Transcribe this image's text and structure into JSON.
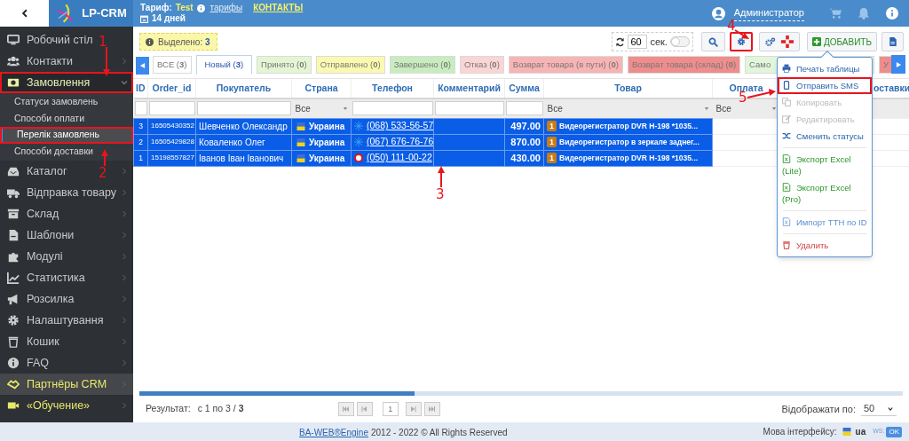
{
  "header": {
    "logo": "LP-CRM",
    "tariff_label": "Тариф:",
    "tariff": "Test",
    "tariffs_link": "тарифы",
    "contacts_link": "КОНТАКТЫ",
    "days": "14 дней",
    "user": "Администратор"
  },
  "sidebar": {
    "items": [
      {
        "label": "Робочий стіл",
        "submenu": false,
        "kind": "normal",
        "annotated": false
      },
      {
        "label": "Контакти",
        "submenu": true,
        "kind": "normal",
        "annotated": false
      },
      {
        "label": "Замовлення",
        "submenu": true,
        "kind": "normal",
        "annotated": true,
        "expanded": true,
        "children": [
          {
            "label": "Статуси замовлень",
            "selected": false,
            "annotated": false
          },
          {
            "label": "Способи оплати",
            "selected": false,
            "annotated": false
          },
          {
            "label": "Перелік замовлень",
            "selected": true,
            "annotated": true
          },
          {
            "label": "Способи доставки",
            "selected": false,
            "annotated": false
          }
        ]
      },
      {
        "label": "Каталог",
        "submenu": true,
        "kind": "normal",
        "annotated": false
      },
      {
        "label": "Відправка товару",
        "submenu": true,
        "kind": "normal",
        "annotated": false
      },
      {
        "label": "Склад",
        "submenu": true,
        "kind": "normal",
        "annotated": false
      },
      {
        "label": "Шаблони",
        "submenu": true,
        "kind": "normal",
        "annotated": false
      },
      {
        "label": "Модулі",
        "submenu": true,
        "kind": "normal",
        "annotated": false
      },
      {
        "label": "Статистика",
        "submenu": true,
        "kind": "normal",
        "annotated": false
      },
      {
        "label": "Розсилка",
        "submenu": true,
        "kind": "normal",
        "annotated": false
      },
      {
        "label": "Налаштування",
        "submenu": true,
        "kind": "normal",
        "annotated": false
      },
      {
        "label": "Кошик",
        "submenu": true,
        "kind": "normal",
        "annotated": false
      },
      {
        "label": "FAQ",
        "submenu": true,
        "kind": "normal",
        "annotated": false
      },
      {
        "label": "Партнёры CRM",
        "submenu": true,
        "kind": "partner",
        "annotated": false
      },
      {
        "label": "«Обучение»",
        "submenu": true,
        "kind": "promo",
        "annotated": false
      }
    ]
  },
  "toolbar": {
    "selected_label": "Выделено:",
    "selected_count": "3",
    "refresh_seconds": "60",
    "seconds_unit": "сек.",
    "auto_refresh": false,
    "settings_annotated": true,
    "add_label": "ДОБАВИТЬ"
  },
  "tabs": [
    {
      "label": "ВСЕ (**3**)",
      "selected": false,
      "color": "#ffffff"
    },
    {
      "label": "Новый (**3**)",
      "selected": true,
      "color": "#ffffff"
    },
    {
      "label": "Принято (**0**)",
      "selected": false,
      "color": "#e4f5d4"
    },
    {
      "label": "Отправлено (**0**)",
      "selected": false,
      "color": "#fbf9b0"
    },
    {
      "label": "Завершено (**0**)",
      "selected": false,
      "color": "#c9ecbf"
    },
    {
      "label": "Отказ (**0**)",
      "selected": false,
      "color": "#fbd4d4"
    },
    {
      "label": "Возврат товара (в пути) (**0**)",
      "selected": false,
      "color": "#f8b4b4"
    },
    {
      "label": "Возврат товара (склад) (**0**)",
      "selected": false,
      "color": "#ef8d8d"
    },
    {
      "label": "Само",
      "selected": false,
      "color": "#e2f6dc"
    },
    {
      "label": "У",
      "selected": false,
      "color": "#ef8d8d"
    }
  ],
  "table": {
    "columns": [
      "ID",
      "Order_id",
      "Покупатель",
      "Страна",
      "Телефон",
      "Комментарий",
      "Сумма",
      "Товар",
      "Оплата",
      "",
      "оставки"
    ],
    "filters": [
      {
        "kind": "input"
      },
      {
        "kind": "input"
      },
      {
        "kind": "input"
      },
      {
        "kind": "select",
        "value": "Все"
      },
      {
        "kind": "input"
      },
      {
        "kind": "input"
      },
      {
        "kind": "input"
      },
      {
        "kind": "select",
        "value": "Все"
      },
      {
        "kind": "select",
        "value": "Все"
      }
    ],
    "rows": [
      {
        "id": "3",
        "order_id": "16505430352",
        "buyer": "Шевченко Олександр",
        "country": "Украина",
        "kind": "star",
        "phone": "(068) 533-56-57",
        "sum": "497.00",
        "qty": "1",
        "product": "Видеорегистратор DVR H-198 *1035...",
        "selected": true
      },
      {
        "id": "2",
        "order_id": "16505429828",
        "buyer": "Коваленко Олег",
        "country": "Украина",
        "kind": "star",
        "phone": "(067) 676-76-76",
        "sum": "870.00",
        "qty": "1",
        "product": "Видеорегистратор в зеркале заднег...",
        "selected": true
      },
      {
        "id": "1",
        "order_id": "15198557827",
        "buyer": "Іванов Іван Іванович",
        "country": "Украина",
        "kind": "ring",
        "phone": "(050) 111-00-22",
        "sum": "430.00",
        "qty": "1",
        "product": "Видеорегистратор DVR H-198 *1035...",
        "selected": true
      }
    ]
  },
  "menu": {
    "items": [
      {
        "label": "Печать таблицы",
        "kind": "print",
        "disabled": false,
        "annotated": false
      },
      {
        "label": "Отправить SMS",
        "kind": "sms",
        "disabled": false,
        "annotated": true
      },
      {
        "label": "Копировать",
        "kind": "copy",
        "disabled": true,
        "annotated": false
      },
      {
        "label": "Редактировать",
        "kind": "edit",
        "disabled": true,
        "annotated": false
      },
      {
        "label": "Сменить статусы",
        "kind": "shuffle",
        "disabled": false,
        "annotated": false
      },
      {
        "label": "Экспорт Excel (Lite)",
        "kind": "excel",
        "disabled": false,
        "annotated": false
      },
      {
        "label": "Экспорт Excel (Pro)",
        "kind": "excel",
        "disabled": false,
        "annotated": false
      },
      {
        "label": "Импорт ТТН по ID",
        "kind": "import",
        "disabled": false,
        "annotated": false
      },
      {
        "label": "Удалить",
        "kind": "delete",
        "disabled": false,
        "annotated": false
      }
    ]
  },
  "pagination": {
    "result_label": "Результат:",
    "range": "с 1 по 3 / **3**",
    "page": "1",
    "per_page_label": "Відображати по:",
    "per_page": "50"
  },
  "footer": {
    "link": "BA-WEB®Engine",
    "text": "2012 - 2022 © All Rights Reserved",
    "lang_label": "Мова інтерфейсу:",
    "lang": "ua",
    "ws_label": "WS:",
    "ws": "OK"
  },
  "annotations": [
    {
      "label": "1"
    },
    {
      "label": "2"
    },
    {
      "label": "3"
    },
    {
      "label": "4"
    },
    {
      "label": "5"
    }
  ]
}
